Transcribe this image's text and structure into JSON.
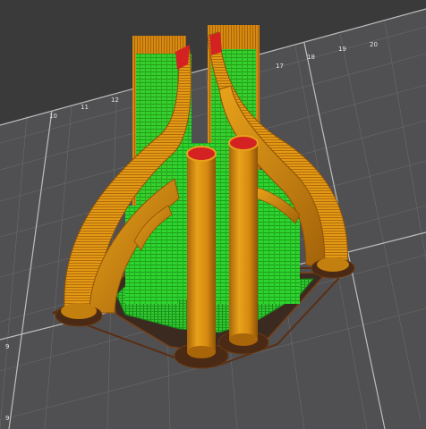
{
  "viewer": {
    "background_color": "#3a3a3a",
    "bed_color": "#505052",
    "grid_minor_color": "#6e6e70",
    "grid_major_color": "#bdbdbd",
    "perimeter_color": "#e69a16",
    "support_color": "#2fd52f",
    "top_solid_color": "#d42222",
    "skirt_color": "#5a2e14"
  },
  "bed": {
    "tick_labels_top": [
      "10",
      "11",
      "12",
      "17",
      "18",
      "19",
      "20"
    ],
    "tick_labels_side": [
      "9",
      "9"
    ]
  }
}
